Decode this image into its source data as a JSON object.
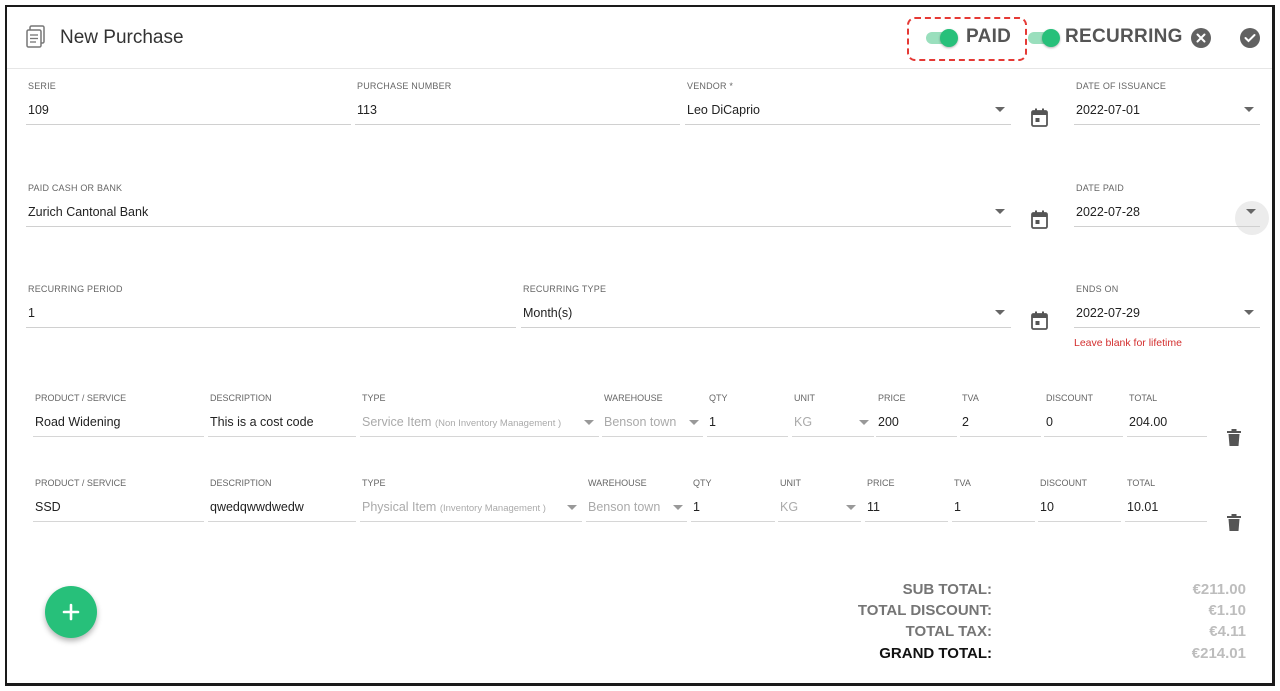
{
  "header": {
    "title": "New Purchase",
    "paid_label": "PAID",
    "recurring_label": "RECURRING",
    "paid_on": true,
    "recurring_on": true
  },
  "form": {
    "serie": {
      "label": "SERIE",
      "value": "109"
    },
    "purchase_number": {
      "label": "PURCHASE NUMBER",
      "value": "113"
    },
    "vendor": {
      "label": "VENDOR *",
      "value": "Leo DiCaprio"
    },
    "date_of_issuance": {
      "label": "DATE OF ISSUANCE",
      "value": "2022-07-01"
    },
    "paid_cash_or_bank": {
      "label": "PAID CASH OR BANK",
      "value": "Zurich Cantonal Bank"
    },
    "date_paid": {
      "label": "DATE PAID",
      "value": "2022-07-28"
    },
    "recurring_period": {
      "label": "RECURRING PERIOD",
      "value": "1"
    },
    "recurring_type": {
      "label": "RECURRING TYPE",
      "value": "Month(s)"
    },
    "ends_on": {
      "label": "ENDS ON",
      "value": "2022-07-29",
      "helper": "Leave blank for lifetime"
    }
  },
  "columns": {
    "product": "PRODUCT / SERVICE",
    "description": "DESCRIPTION",
    "type": "TYPE",
    "warehouse": "WAREHOUSE",
    "qty": "QTY",
    "unit": "UNIT",
    "price": "PRICE",
    "tva": "TVA",
    "discount": "DISCOUNT",
    "total": "TOTAL"
  },
  "items": [
    {
      "product": "Road Widening",
      "description": "This is a cost code",
      "type": "Service Item",
      "type_note": "(Non Inventory Management )",
      "warehouse": "Benson town",
      "qty": "1",
      "unit": "KG",
      "price": "200",
      "tva": "2",
      "discount": "0",
      "total": "204.00"
    },
    {
      "product": "SSD",
      "description": "qwedqwwdwedw",
      "type": "Physical Item",
      "type_note": "(Inventory Management )",
      "warehouse": "Benson town",
      "qty": "1",
      "unit": "KG",
      "price": "11",
      "tva": "1",
      "discount": "10",
      "total": "10.01"
    }
  ],
  "totals": {
    "sub_total_label": "SUB TOTAL:",
    "sub_total": "€211.00",
    "total_discount_label": "TOTAL DISCOUNT:",
    "total_discount": "€1.10",
    "total_tax_label": "TOTAL TAX:",
    "total_tax": "€4.11",
    "grand_total_label": "GRAND TOTAL:",
    "grand_total": "€214.01"
  },
  "colors": {
    "accent": "#27c07a",
    "error": "#d32f2f",
    "highlight": "#e53935"
  },
  "icons": [
    "document-icon",
    "close-circle-icon",
    "check-circle-icon",
    "calendar-icon",
    "chevron-down-icon",
    "trash-icon",
    "plus-icon"
  ]
}
